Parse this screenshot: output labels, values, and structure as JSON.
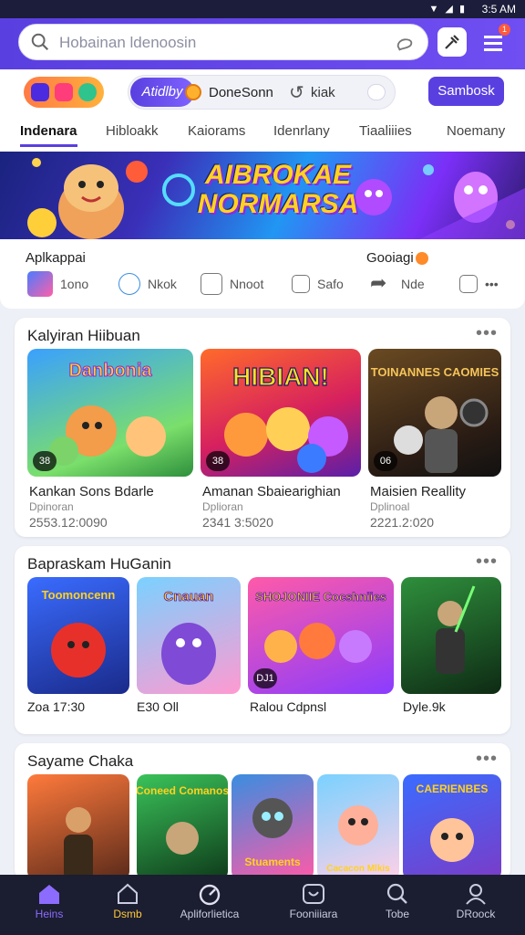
{
  "status": {
    "time": "3:5 AM",
    "signals": "▼ ◢ ▮"
  },
  "search": {
    "placeholder": "Hobainan ldenoosin"
  },
  "header": {
    "logo": "app-logo",
    "promo_chip": "Atidlby",
    "promo_text": "DoneSonn",
    "promo_text2": "kiak",
    "cta_label": "Sambosk",
    "notif_count": "1"
  },
  "tabs": [
    "Indenara",
    "Hibloakk",
    "Kaiorams",
    "Idenrlany",
    "Tiaaliiies",
    "Noemany"
  ],
  "banner": {
    "title": "AIBROKAE NORMARSA"
  },
  "apps": {
    "heading": "Aplkappai",
    "right_heading": "Gooiagi",
    "items": [
      "1ono",
      "Nkok",
      "Nnoot",
      "Safo",
      "Nde",
      "•••"
    ]
  },
  "sections": [
    {
      "title": "Kalyiran Hiibuan",
      "cards": [
        {
          "art": "Danbonia",
          "badge": "38",
          "title": "Kankan Sons Bdarle",
          "sub": "Dpinoran",
          "num": "2553.12:0090"
        },
        {
          "art": "HIBIAN!",
          "badge": "38",
          "title": "Amanan Sbaiearighian",
          "sub": "Dplioran",
          "num": "2341 3:5020"
        },
        {
          "art": "TOINANNES CAOMIES",
          "badge": "06",
          "title": "Maisien Reallity",
          "sub": "Dplinoal",
          "num": "2221.2:020"
        }
      ]
    },
    {
      "title": "Bapraskam HuGanin",
      "cards": [
        {
          "art": "Toomoncenn",
          "badge": "",
          "label": "Zoa 17:30"
        },
        {
          "art": "Cnauan",
          "badge": "",
          "label": "E30 Oll"
        },
        {
          "art": "SHOJONIIE Cocshniies",
          "badge": "DJ1",
          "label": "Ralou Cdpnsl"
        },
        {
          "art": "",
          "badge": "",
          "label": "Dyle.9k"
        }
      ]
    },
    {
      "title": "Sayame Chaka",
      "cards": [
        {
          "art": ""
        },
        {
          "art": "Coneed Comanos"
        },
        {
          "art": "Stuaments"
        },
        {
          "art": "Cacacon Mlkis"
        },
        {
          "art": "CAERIENBES"
        }
      ]
    }
  ],
  "bottom_nav": [
    "Heins",
    "Dsmb",
    "Apliforlietica",
    "Fooniiiara",
    "Tobe",
    "DRoock"
  ],
  "colors": {
    "accent": "#5a3fe0",
    "nav_bg": "#1b1d30",
    "active_nav": "#8c6cff"
  }
}
